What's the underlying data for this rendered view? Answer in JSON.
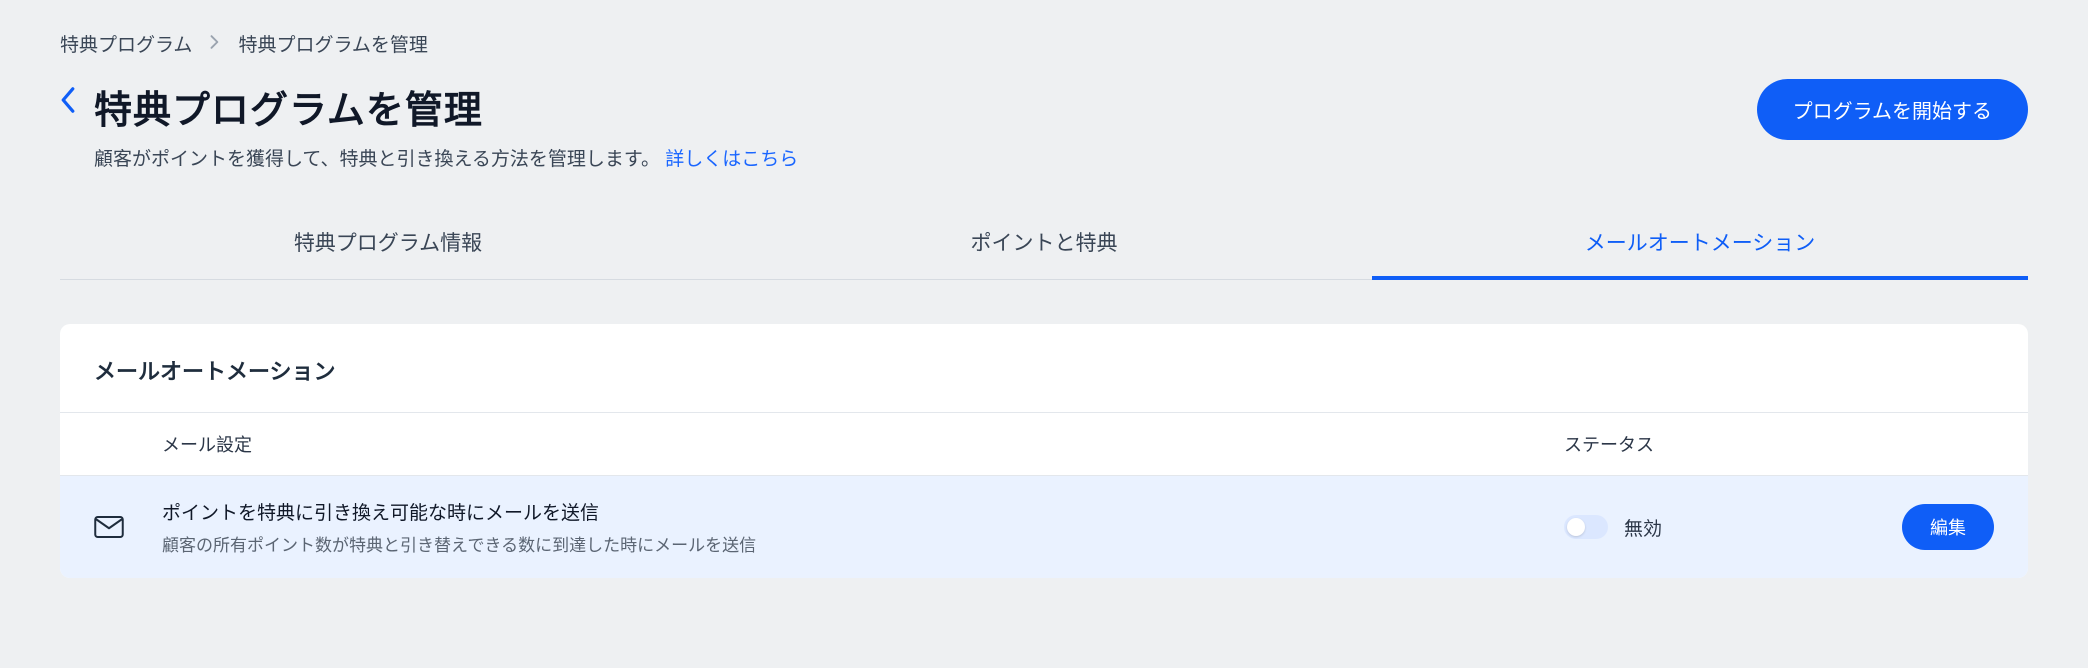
{
  "breadcrumb": {
    "root": "特典プログラム",
    "current": "特典プログラムを管理"
  },
  "header": {
    "title": "特典プログラムを管理",
    "subtitle_prefix": "顧客がポイントを獲得して、特典と引き換える方法を管理します。",
    "learn_more": "詳しくはこちら",
    "primary_action": "プログラムを開始する"
  },
  "tabs": [
    {
      "label": "特典プログラム情報",
      "active": false
    },
    {
      "label": "ポイントと特典",
      "active": false
    },
    {
      "label": "メールオートメーション",
      "active": true
    }
  ],
  "section": {
    "title": "メールオートメーション",
    "columns": {
      "name": "メール設定",
      "status": "ステータス"
    },
    "rows": [
      {
        "icon": "mail-icon",
        "title": "ポイントを特典に引き換え可能な時にメールを送信",
        "description": "顧客の所有ポイント数が特典と引き替えできる数に到達した時にメールを送信",
        "status_label": "無効",
        "enabled": false,
        "action_label": "編集"
      }
    ]
  },
  "colors": {
    "primary": "#0f5ef7",
    "row_bg": "#eaf2ff",
    "page_bg": "#eef0f2"
  }
}
